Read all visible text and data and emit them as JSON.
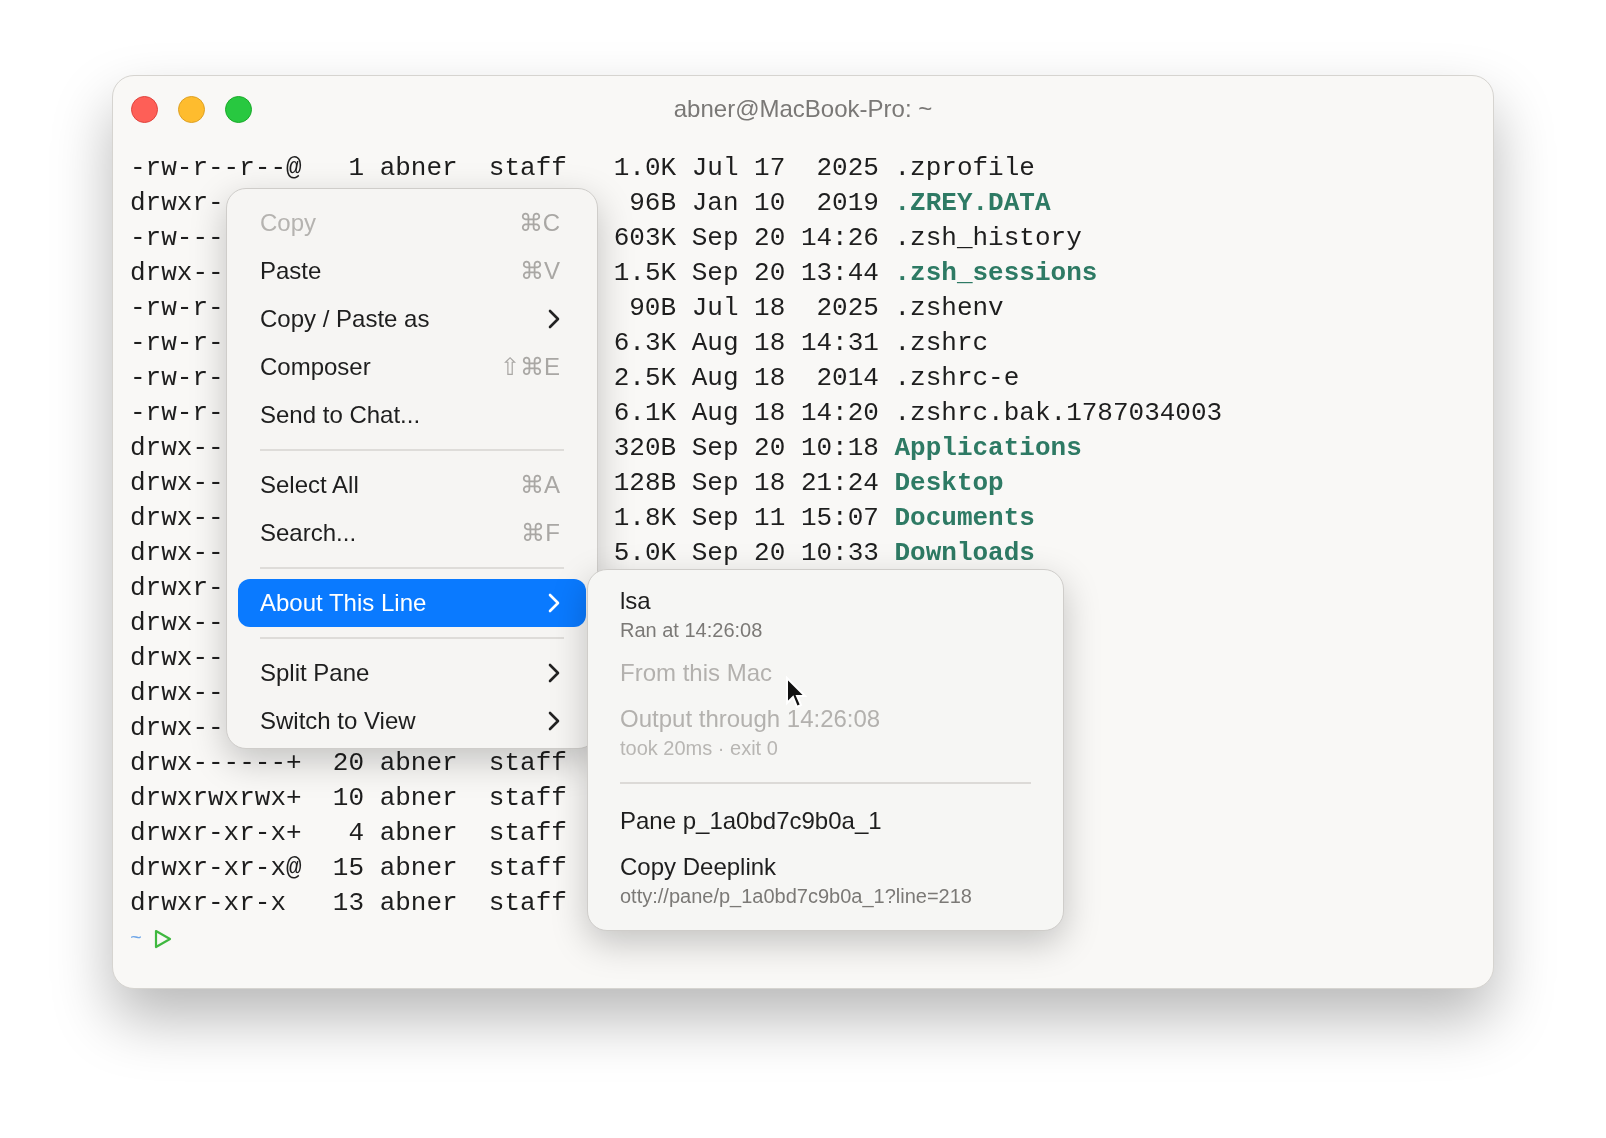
{
  "window": {
    "title": "abner@MacBook-Pro: ~"
  },
  "terminal": {
    "rows": [
      {
        "left": "-rw-r--r--@   1 abner  staff",
        "size": "1.0K",
        "date": "Jul 17  2025",
        "name": ".zprofile",
        "kind": "file"
      },
      {
        "left": "drwxr-",
        "size": "96B",
        "date": "Jan 10  2019",
        "name": ".ZREY.DATA",
        "kind": "dir"
      },
      {
        "left": "-rw---",
        "size": "603K",
        "date": "Sep 20 14:26",
        "name": ".zsh_history",
        "kind": "file"
      },
      {
        "left": "drwx--",
        "size": "1.5K",
        "date": "Sep 20 13:44",
        "name": ".zsh_sessions",
        "kind": "dir"
      },
      {
        "left": "-rw-r-",
        "size": "90B",
        "date": "Jul 18  2025",
        "name": ".zshenv",
        "kind": "file"
      },
      {
        "left": "-rw-r-",
        "size": "6.3K",
        "date": "Aug 18 14:31",
        "name": ".zshrc",
        "kind": "file"
      },
      {
        "left": "-rw-r-",
        "size": "2.5K",
        "date": "Aug 18  2014",
        "name": ".zshrc-e",
        "kind": "file"
      },
      {
        "left": "-rw-r-",
        "size": "6.1K",
        "date": "Aug 18 14:20",
        "name": ".zshrc.bak.1787034003",
        "kind": "file"
      },
      {
        "left": "drwx--",
        "size": "320B",
        "date": "Sep 20 10:18",
        "name": "Applications",
        "kind": "dir"
      },
      {
        "left": "drwx--",
        "size": "128B",
        "date": "Sep 18 21:24",
        "name": "Desktop",
        "kind": "dir"
      },
      {
        "left": "drwx--",
        "size": "1.8K",
        "date": "Sep 11 15:07",
        "name": "Documents",
        "kind": "dir"
      },
      {
        "left": "drwx--",
        "size": "5.0K",
        "date": "Sep 20 10:33",
        "name": "Downloads",
        "kind": "dir"
      },
      {
        "left": "drwxr-"
      },
      {
        "left": "drwx--"
      },
      {
        "left": "drwx--"
      },
      {
        "left": "drwx--"
      },
      {
        "left": "drwx--"
      },
      {
        "left": "drwx------+  20 abner  staff"
      },
      {
        "left": "drwxrwxrwx+  10 abner  staff"
      },
      {
        "left": "drwxr-xr-x+   4 abner  staff"
      },
      {
        "left": "drwxr-xr-x@  15 abner  staff"
      },
      {
        "left": "drwxr-xr-x   13 abner  staff"
      }
    ],
    "prompt": {
      "path": "~"
    }
  },
  "context_menu": {
    "items": [
      {
        "kind": "item",
        "label": "Copy",
        "shortcut": "⌘C",
        "disabled": true,
        "submenu": false,
        "selected": false
      },
      {
        "kind": "item",
        "label": "Paste",
        "shortcut": "⌘V",
        "disabled": false,
        "submenu": false,
        "selected": false
      },
      {
        "kind": "item",
        "label": "Copy / Paste as",
        "disabled": false,
        "submenu": true,
        "selected": false
      },
      {
        "kind": "item",
        "label": "Composer",
        "shortcut": "⇧⌘E",
        "disabled": false,
        "submenu": false,
        "selected": false
      },
      {
        "kind": "item",
        "label": "Send to Chat...",
        "disabled": false,
        "submenu": false,
        "selected": false
      },
      {
        "kind": "separator"
      },
      {
        "kind": "item",
        "label": "Select All",
        "shortcut": "⌘A",
        "disabled": false,
        "submenu": false,
        "selected": false
      },
      {
        "kind": "item",
        "label": "Search...",
        "shortcut": "⌘F",
        "disabled": false,
        "submenu": false,
        "selected": false
      },
      {
        "kind": "separator"
      },
      {
        "kind": "item",
        "label": "About This Line",
        "disabled": false,
        "submenu": true,
        "selected": true
      },
      {
        "kind": "separator"
      },
      {
        "kind": "item",
        "label": "Split Pane",
        "disabled": false,
        "submenu": true,
        "selected": false
      },
      {
        "kind": "item",
        "label": "Switch to View",
        "disabled": false,
        "submenu": true,
        "selected": false
      }
    ]
  },
  "submenu": {
    "items": [
      {
        "kind": "item",
        "label": "lsa",
        "detail": "Ran at 14:26:08",
        "disabled": false
      },
      {
        "kind": "item",
        "label": "From this Mac",
        "disabled": true
      },
      {
        "kind": "item",
        "label": "Output through 14:26:08",
        "detail": "took 20ms · exit 0",
        "disabled": true
      },
      {
        "kind": "separator"
      },
      {
        "kind": "item",
        "label": "Pane p_1a0bd7c9b0a_1",
        "disabled": false
      },
      {
        "kind": "item",
        "label": "Copy Deeplink",
        "detail": "otty://pane/p_1a0bd7c9b0a_1?line=218",
        "disabled": false
      }
    ]
  }
}
